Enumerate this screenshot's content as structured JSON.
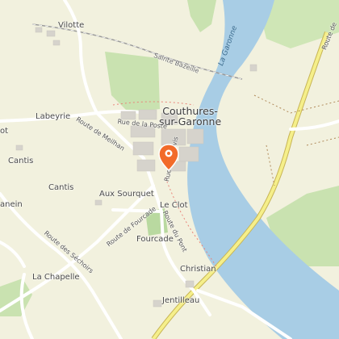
{
  "map": {
    "places": {
      "vilotte": "Vilotte",
      "labeyrie": "Labeyrie",
      "cantis_1": "Cantis",
      "cantis_2": "Cantis",
      "aux_sourquet": "Aux Sourquet",
      "le_clot": "Le Clot",
      "fourcade": "Fourcade",
      "la_chapelle": "La Chapelle",
      "christian": "Christian",
      "jentilleau": "Jentilleau",
      "lanein": "anein",
      "ot": "ot"
    },
    "town": {
      "line1": "Couthures-",
      "line2": "sur-Garonne"
    },
    "roads": {
      "route_de_meilhan": "Route de Meilhan",
      "rue_de_la_poste": "Rue de la Poste",
      "route_de_fourcade": "Route de Fourcade",
      "route_des_sechoirs": "Route des Séchoirs",
      "route_du_pont": "Route du Pont",
      "rue_vertical": "Rue de Sauvis",
      "route_de_far_right": "Route de"
    },
    "waterway": "La Garonne",
    "railway": "Sainte Bazeille",
    "marker": {
      "icon": "location-pin-icon",
      "color": "#f26b2a"
    },
    "colors": {
      "background": "#f2f1de",
      "river": "#a8cde5",
      "forest": "#c9e2b0",
      "major_road": "#f5ef8a"
    }
  }
}
